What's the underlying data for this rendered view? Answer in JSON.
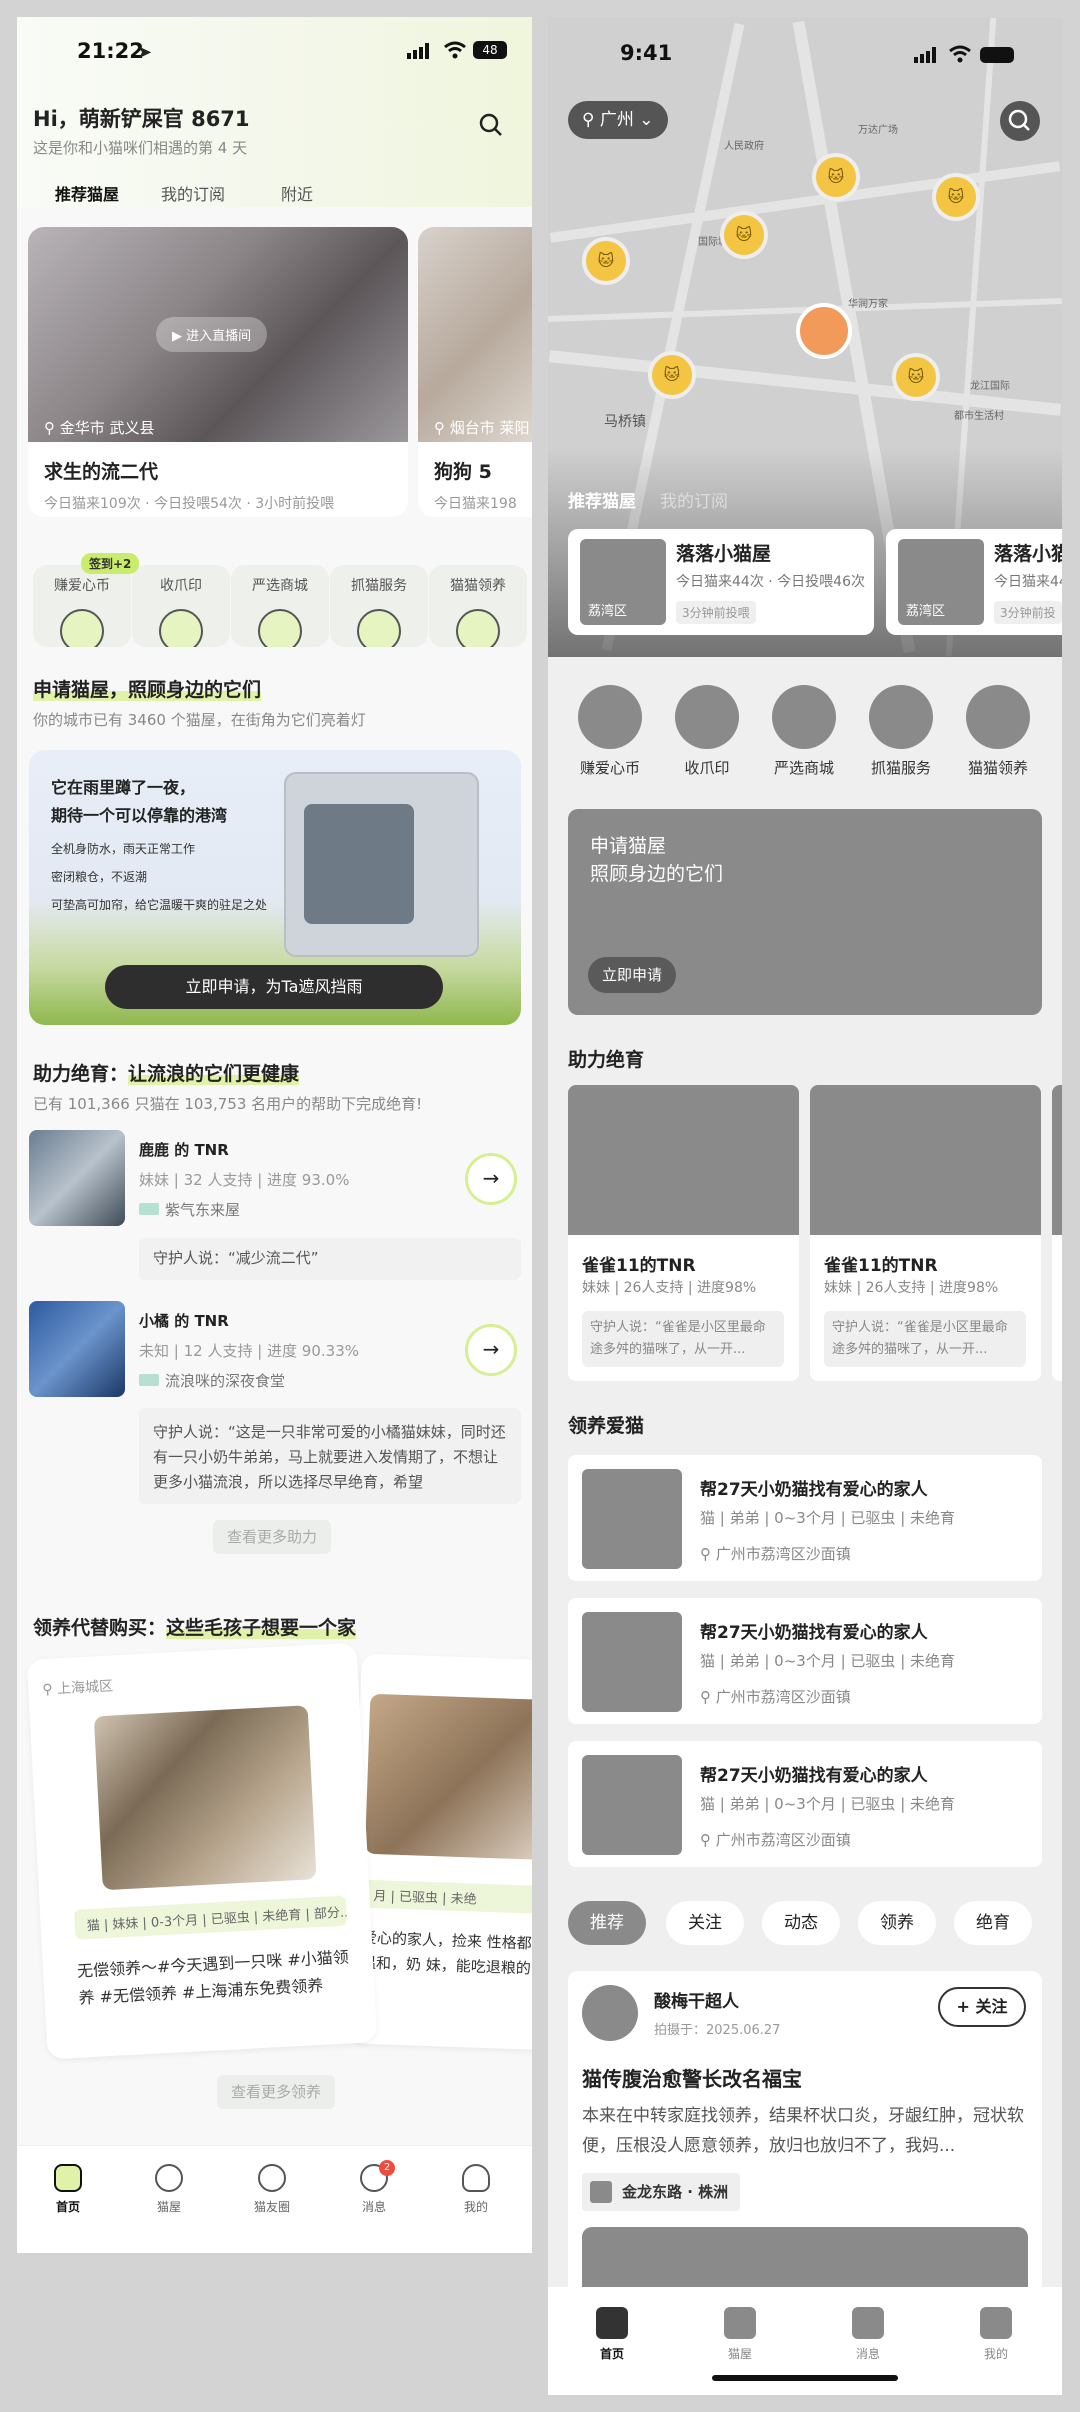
{
  "phone1": {
    "status": {
      "time": "21:22",
      "battery": "48"
    },
    "greeting": "Hi，萌新铲屎官 8671",
    "subtitle": "这是你和小猫咪们相遇的第 4 天",
    "tabs": [
      "推荐猫屋",
      "我的订阅",
      "附近"
    ],
    "live_cards": [
      {
        "location": "金华市 武义县",
        "title": "求生的流二代",
        "meta": "今日猫来109次 · 今日投喂54次 · 3小时前投喂",
        "live": "进入直播间"
      },
      {
        "location": "烟台市 莱阳",
        "title": "狗狗 5",
        "meta": "今日猫来198"
      }
    ],
    "checkin_badge": "签到+2",
    "services": [
      "赚爱心币",
      "收爪印",
      "严选商城",
      "抓猫服务",
      "猫猫领养"
    ],
    "apply": {
      "title": "申请猫屋，照顾身边的它们",
      "sub": "你的城市已有 3460 个猫屋，在街角为它们亮着灯",
      "line1": "它在雨里蹲了一夜，",
      "line2": "期待一个可以停靠的港湾",
      "f1": "全机身防水，雨天正常工作",
      "f2": "密闭粮仓，不返潮",
      "f3": "可垫高可加帘，给它温暖干爽的驻足之处",
      "button": "立即申请，为Ta遮风挡雨"
    },
    "tnr": {
      "title_a": "助力绝育：",
      "title_b": "让流浪的它们更健康",
      "sub": "已有 101,366 只猫在 103,753 名用户的帮助下完成绝育!",
      "items": [
        {
          "name": "鹿鹿 的 TNR",
          "meta": "妹妹 | 32 人支持 | 进度 93.0%",
          "place": "紫气东来屋",
          "quote": "守护人说：“减少流二代”"
        },
        {
          "name": "小橘 的 TNR",
          "meta": "未知 | 12 人支持 | 进度 90.33%",
          "place": "流浪咪的深夜食堂",
          "quote": "守护人说：“这是一只非常可爱的小橘猫妹妹，同时还有一只小奶牛弟弟，马上就要进入发情期了，不想让更多小猫流浪，所以选择尽早绝育，希望"
        }
      ],
      "more": "查看更多助力"
    },
    "adopt": {
      "title_a": "领养代替购买：",
      "title_b": "这些毛孩子想要一个家",
      "card": {
        "location": "上海城区",
        "tags": "猫 | 妹妹 | 0-3个月 | 已驱虫 | 未绝育 | 部分...",
        "desc": "无偿领养～#今天遇到一只咪 #小猫领养 #无偿领养 #上海浦东免费领养"
      },
      "card2": {
        "tags": "月 | 已驱虫 | 未绝",
        "desc": "爱心的家人，捡来 性格都很温和，奶 妹，能吃退粮的，"
      },
      "more": "查看更多领养"
    },
    "tabbar": [
      "首页",
      "猫屋",
      "猫友圈",
      "消息",
      "我的"
    ],
    "msg_badge": "2"
  },
  "phone2": {
    "status": {
      "time": "9:41"
    },
    "city": "广州",
    "map_labels": [
      "马桥镇",
      "万达广场",
      "华润万家",
      "龙江国际",
      "都市生活村",
      "国际城",
      "人民政府"
    ],
    "map_tabs": [
      "推荐猫屋",
      "我的订阅"
    ],
    "cat_cards": [
      {
        "title": "落落小猫屋",
        "meta": "今日猫来44次 · 今日投喂46次",
        "time": "3分钟前投喂",
        "district": "荔湾区"
      },
      {
        "title": "落落小猫屋",
        "meta": "今日猫来44",
        "time": "3分钟前投",
        "district": "荔湾区"
      }
    ],
    "services": [
      "赚爱心币",
      "收爪印",
      "严选商城",
      "抓猫服务",
      "猫猫领养"
    ],
    "apply": {
      "line1": "申请猫屋",
      "line2": "照顾身边的它们",
      "button": "立即申请"
    },
    "tnr_title": "助力绝育",
    "tnr_cards": [
      {
        "title": "雀雀11的TNR",
        "meta": "妹妹 | 26人支持 | 进度98%",
        "quote": "守护人说：“雀雀是小区里最命途多舛的猫咪了，从一开..."
      },
      {
        "title": "雀雀11的TNR",
        "meta": "妹妹 | 26人支持 | 进度98%",
        "quote": "守护人说：“雀雀是小区里最命途多舛的猫咪了，从一开..."
      }
    ],
    "adopt_title": "领养爱猫",
    "adopt_items": [
      {
        "title": "帮27天小奶猫找有爱心的家人",
        "meta": "猫 | 弟弟 | 0~3个月 | 已驱虫 | 未绝育",
        "loc": "广州市荔湾区沙面镇"
      },
      {
        "title": "帮27天小奶猫找有爱心的家人",
        "meta": "猫 | 弟弟 | 0~3个月 | 已驱虫 | 未绝育",
        "loc": "广州市荔湾区沙面镇"
      },
      {
        "title": "帮27天小奶猫找有爱心的家人",
        "meta": "猫 | 弟弟 | 0~3个月 | 已驱虫 | 未绝育",
        "loc": "广州市荔湾区沙面镇"
      }
    ],
    "feed_tabs": [
      "推荐",
      "关注",
      "动态",
      "领养",
      "绝育"
    ],
    "post": {
      "user": "酸梅干超人",
      "date": "拍摄于：2025.06.27",
      "follow": "+ 关注",
      "title": "猫传腹治愈警长改名福宝",
      "body": "本来在中转家庭找领养，结果杯状口炎，牙龈红肿，冠状软便，压根没人愿意领养，放归也放归不了，我妈...",
      "tag": "金龙东路 · 株洲"
    },
    "tabbar": [
      "首页",
      "猫屋",
      "消息",
      "我的"
    ]
  },
  "colors": {
    "accent": "#c9ec6a",
    "highlight": "#dff2a8",
    "placeholder": "#8a8a8a",
    "dark_button": "#2e2e2e"
  }
}
